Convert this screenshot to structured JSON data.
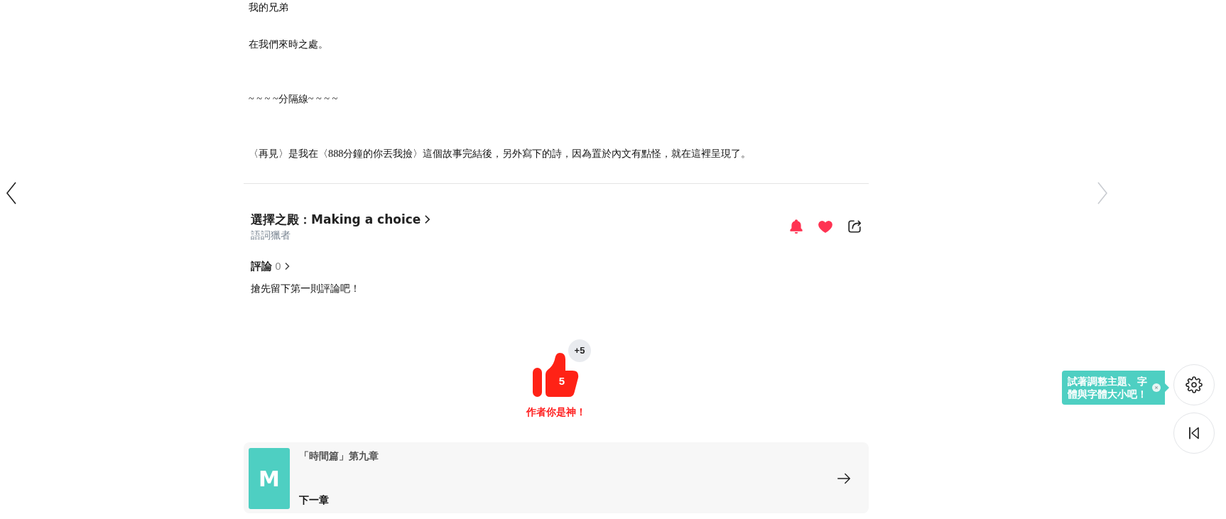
{
  "article": {
    "paragraphs": [
      "我的兄弟",
      "在我們來時之處。",
      "~ ~ ~ ~分隔線~ ~ ~ ~",
      "〈再見〉是我在〈888分鐘的你丟我撿〉這個故事完結後，另外寫下的詩，因為置於內文有點怪，就在這裡呈現了。"
    ]
  },
  "nav": {
    "previous": {
      "disabled": false
    },
    "next": {
      "disabled": true
    }
  },
  "story": {
    "title": "選擇之殿：Making a choice",
    "author": "語詞獵者",
    "actions": [
      {
        "kind": "bell",
        "on": true
      },
      {
        "kind": "heart",
        "on": true
      },
      {
        "kind": "share",
        "on": false
      }
    ]
  },
  "comments": {
    "label": "評論",
    "count": "0",
    "empty_text": "搶先留下第一則評論吧！"
  },
  "cheer": {
    "count": "5",
    "badge": "+5",
    "caption": "作者你是神！"
  },
  "next_chapter": {
    "cover_letter": "M",
    "title": "「時間篇」第九章",
    "label": "下一章"
  },
  "tooltip": {
    "text": "試著調整主題、字體與字體大小吧！"
  }
}
